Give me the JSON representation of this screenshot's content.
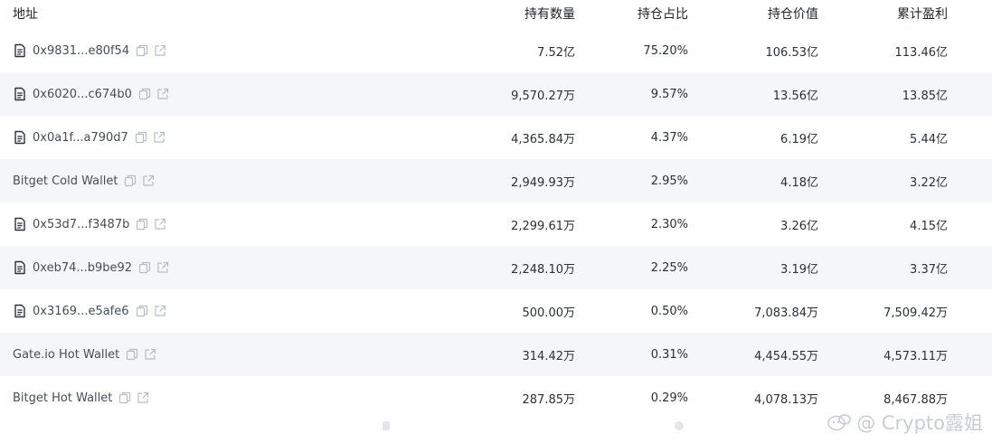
{
  "header": {
    "address": "地址",
    "holdings": "持有数量",
    "pct": "持仓占比",
    "value": "持仓价值",
    "pnl": "累计盈利"
  },
  "rows": [
    {
      "address": "0x9831...e80f54",
      "is_contract": true,
      "holdings": "7.52亿",
      "pct": "75.20%",
      "value": "106.53亿",
      "pnl": "113.46亿"
    },
    {
      "address": "0x6020...c674b0",
      "is_contract": true,
      "holdings": "9,570.27万",
      "pct": "9.57%",
      "value": "13.56亿",
      "pnl": "13.85亿"
    },
    {
      "address": "0x0a1f...a790d7",
      "is_contract": true,
      "holdings": "4,365.84万",
      "pct": "4.37%",
      "value": "6.19亿",
      "pnl": "5.44亿"
    },
    {
      "address": "Bitget Cold Wallet",
      "is_contract": false,
      "holdings": "2,949.93万",
      "pct": "2.95%",
      "value": "4.18亿",
      "pnl": "3.22亿"
    },
    {
      "address": "0x53d7...f3487b",
      "is_contract": true,
      "holdings": "2,299.61万",
      "pct": "2.30%",
      "value": "3.26亿",
      "pnl": "4.15亿"
    },
    {
      "address": "0xeb74...b9be92",
      "is_contract": true,
      "holdings": "2,248.10万",
      "pct": "2.25%",
      "value": "3.19亿",
      "pnl": "3.37亿"
    },
    {
      "address": "0x3169...e5afe6",
      "is_contract": true,
      "holdings": "500.00万",
      "pct": "0.50%",
      "value": "7,083.84万",
      "pnl": "7,509.42万"
    },
    {
      "address": "Gate.io Hot Wallet",
      "is_contract": false,
      "holdings": "314.42万",
      "pct": "0.31%",
      "value": "4,454.55万",
      "pnl": "4,573.11万"
    },
    {
      "address": "Bitget Hot Wallet",
      "is_contract": false,
      "holdings": "287.85万",
      "pct": "0.29%",
      "value": "4,078.13万",
      "pnl": "8,467.88万"
    }
  ],
  "watermark": {
    "text": "@ Crypto露姐"
  },
  "icons": {
    "contract": "document-icon",
    "copy": "copy-icon",
    "link": "external-link-icon"
  },
  "colors": {
    "text": "#2b2f36",
    "muted": "#474d57",
    "icon": "#b7bdc6",
    "alt_row": "#f5f6fa"
  }
}
